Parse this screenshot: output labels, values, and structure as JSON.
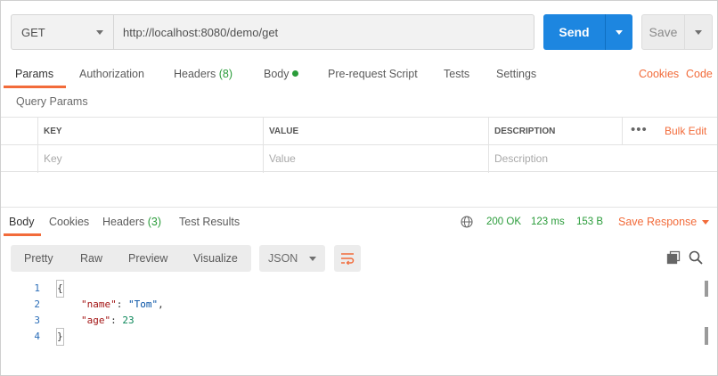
{
  "request": {
    "method": "GET",
    "url": "http://localhost:8080/demo/get",
    "send_label": "Send",
    "save_label": "Save"
  },
  "request_tabs": {
    "params": "Params",
    "authorization": "Authorization",
    "headers": "Headers",
    "headers_count": "(8)",
    "body": "Body",
    "prerequest": "Pre-request Script",
    "tests": "Tests",
    "settings": "Settings",
    "cookies": "Cookies",
    "code": "Code"
  },
  "query_params": {
    "title": "Query Params",
    "columns": [
      "KEY",
      "VALUE",
      "DESCRIPTION"
    ],
    "placeholders": [
      "Key",
      "Value",
      "Description"
    ],
    "more": "•••",
    "bulk_edit": "Bulk Edit"
  },
  "response_tabs": {
    "body": "Body",
    "cookies": "Cookies",
    "headers": "Headers",
    "headers_count": "(3)",
    "test_results": "Test Results"
  },
  "response_status": {
    "status": "200 OK",
    "time": "123 ms",
    "size": "153 B",
    "save_response": "Save Response"
  },
  "response_toolbar": {
    "pretty": "Pretty",
    "raw": "Raw",
    "preview": "Preview",
    "visualize": "Visualize",
    "format": "JSON"
  },
  "response_body": {
    "line_numbers": [
      "1",
      "2",
      "3",
      "4"
    ],
    "open_brace": "{",
    "close_brace": "}",
    "name_key": "\"name\"",
    "name_value": "\"Tom\"",
    "age_key": "\"age\"",
    "age_value": "23"
  },
  "colors": {
    "accent": "#f26b3a",
    "send": "#1d86e0",
    "success": "#2a9c3a"
  }
}
